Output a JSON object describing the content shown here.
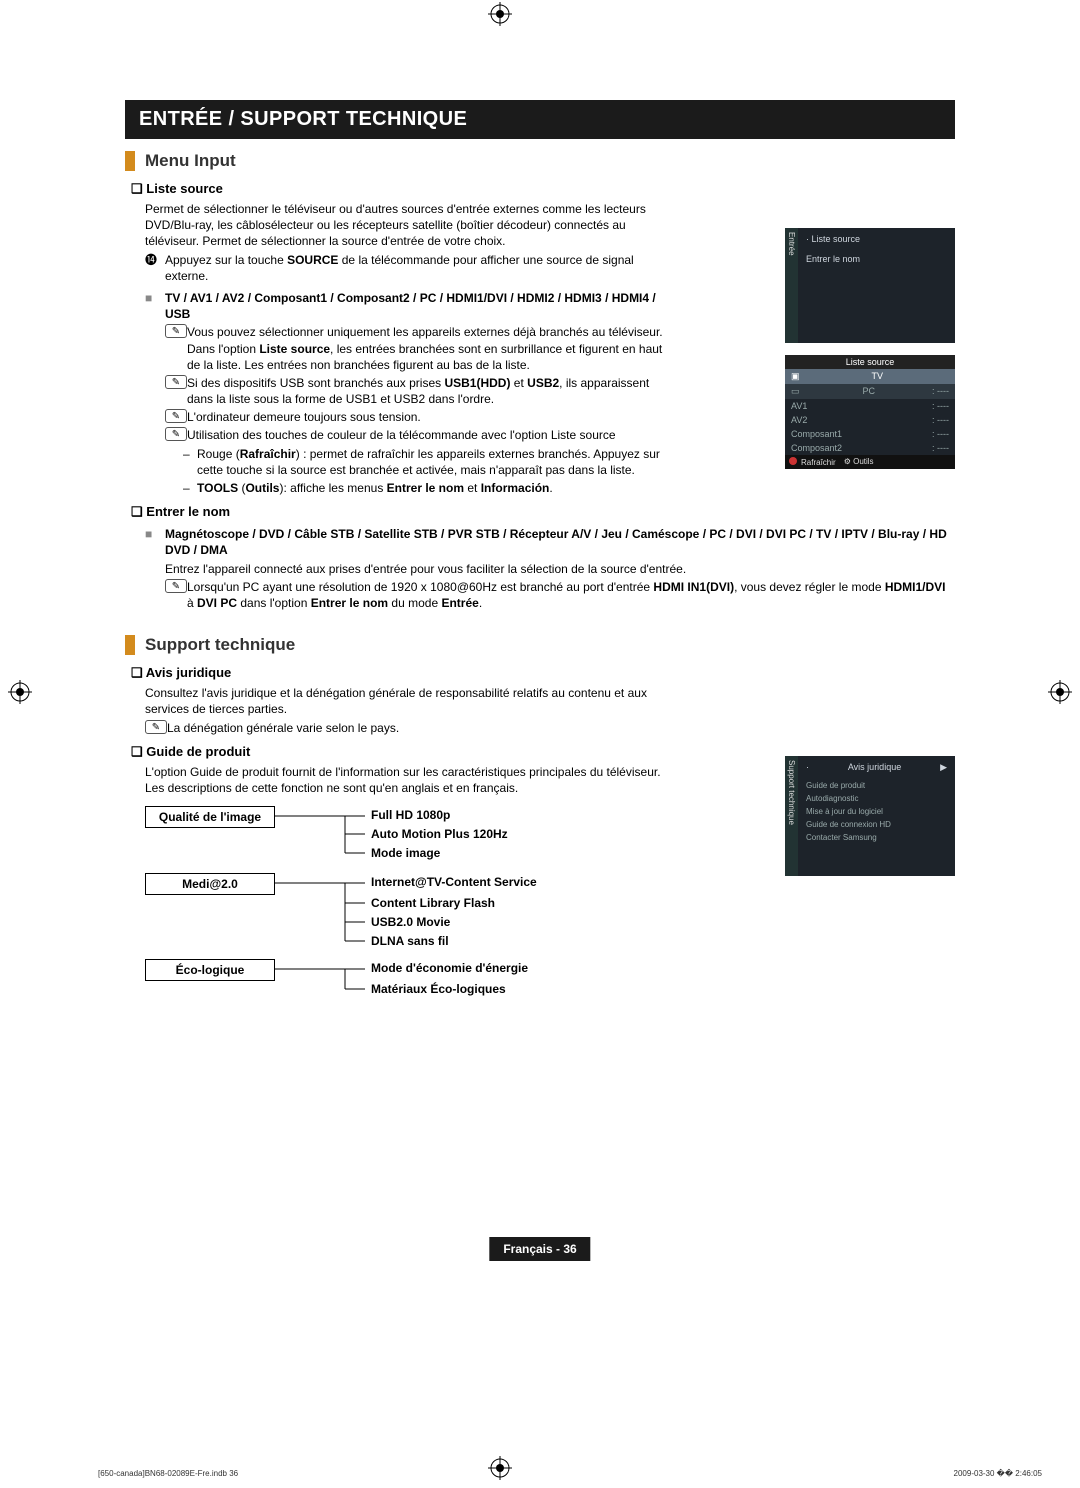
{
  "banner": "ENTRÉE / SUPPORT TECHNIQUE",
  "section1": {
    "title": "Menu Input",
    "liste_source": {
      "heading": "Liste source",
      "p1": "Permet de sélectionner le téléviseur ou d'autres sources d'entrée externes comme les lecteurs DVD/Blu-ray, les câblosélecteur ou les récepteurs satellite (boîtier décodeur) connectés au téléviseur. Permet de sélectionner la source d'entrée de votre choix.",
      "hint_mark": "⓮",
      "hint": "Appuyez sur la touche SOURCE de la télécommande pour afficher une source de signal externe.",
      "sources_line": "TV / AV1 / AV2 / Composant1 / Composant2 / PC / HDMI1/DVI / HDMI2 / HDMI3 / HDMI4 / USB",
      "n1_mark": "✎",
      "n1": "Vous pouvez sélectionner uniquement les appareils externes déjà branchés au téléviseur. Dans l'option Liste source, les entrées branchées sont en surbrillance et figurent en haut de la liste. Les entrées non branchées figurent au bas de la liste.",
      "n2_mark": "✎",
      "n2": "Si des dispositifs USB sont branchés aux prises USB1(HDD) et USB2, ils apparaissent dans la liste sous la forme de USB1 et USB2 dans l'ordre.",
      "n3_mark": "✎",
      "n3": "L'ordinateur demeure toujours sous tension.",
      "n4_mark": "✎",
      "n4": "Utilisation des touches de couleur de la télécommande avec l'option Liste source",
      "d1": "Rouge (Rafraîchir) : permet de rafraîchir les appareils externes branchés. Appuyez sur cette touche si la source est branchée et activée, mais n'apparaît pas dans la liste.",
      "d2": "TOOLS (Outils): affiche les menus Entrer le nom et Información."
    },
    "entrer_le_nom": {
      "heading": "Entrer le nom",
      "sources_line": "Magnétoscope / DVD / Câble STB / Satellite STB / PVR STB / Récepteur A/V / Jeu / Caméscope / PC / DVI / DVI PC / TV / IPTV / Blu-ray / HD DVD / DMA",
      "p1": "Entrez l'appareil connecté aux prises d'entrée pour vous faciliter la sélection de la source d'entrée.",
      "n1_mark": "✎",
      "n1": "Lorsqu'un PC ayant une résolution de 1920 x 1080@60Hz est branché au port d'entrée HDMI IN1(DVI), vous devez régler le mode HDMI1/DVI à DVI PC dans l'option Entrer le nom du mode Entrée."
    }
  },
  "section2": {
    "title": "Support technique",
    "avis": {
      "heading": "Avis juridique",
      "p1": "Consultez l'avis juridique et la dénégation générale de responsabilité relatifs au contenu et aux services de tierces parties.",
      "n1_mark": "✎",
      "n1": "La dénégation générale varie selon le pays."
    },
    "guide": {
      "heading": "Guide de produit",
      "p1": "L'option Guide de produit fournit de l'information sur les caractéristiques principales du téléviseur. Les descriptions de cette fonction ne sont qu'en anglais et en français."
    }
  },
  "flow": {
    "box1": "Qualité de l'image",
    "box2": "Medi@2.0",
    "box3": "Éco-logique",
    "leafs": {
      "l1": "Full HD 1080p",
      "l2": "Auto Motion Plus 120Hz",
      "l3": "Mode image",
      "l4": "Internet@TV-Content Service",
      "l5": "Content Library Flash",
      "l6": "USB2.0 Movie",
      "l7": "DLNA sans fil",
      "l8": "Mode d'économie d'énergie",
      "l9": "Matériaux Éco-logiques"
    }
  },
  "panels": {
    "input_menu": {
      "side": "Entrée",
      "r1": "Liste source",
      "r2": "Entrer le nom"
    },
    "source_list": {
      "header": "Liste source",
      "rows": [
        {
          "name": "TV",
          "val": ""
        },
        {
          "name": "PC",
          "val": ": ----"
        },
        {
          "name": "AV1",
          "val": ": ----"
        },
        {
          "name": "AV2",
          "val": ": ----"
        },
        {
          "name": "Composant1",
          "val": ": ----"
        },
        {
          "name": "Composant2",
          "val": ": ----"
        }
      ],
      "footer1": "Rafraîchir",
      "footer2": "Outils"
    },
    "support_menu": {
      "side": "Support technique",
      "r1": "Avis juridique",
      "rows": [
        "Guide de produit",
        "Autodiagnostic",
        "Mise à jour du logiciel",
        "Guide de connexion HD",
        "Contacter Samsung"
      ]
    }
  },
  "footer_lang": "Français - 36",
  "print_footer_left": "[650-canada]BN68-02089E-Fre.indb   36",
  "print_footer_right": "2009-03-30   �� 2:46:05"
}
